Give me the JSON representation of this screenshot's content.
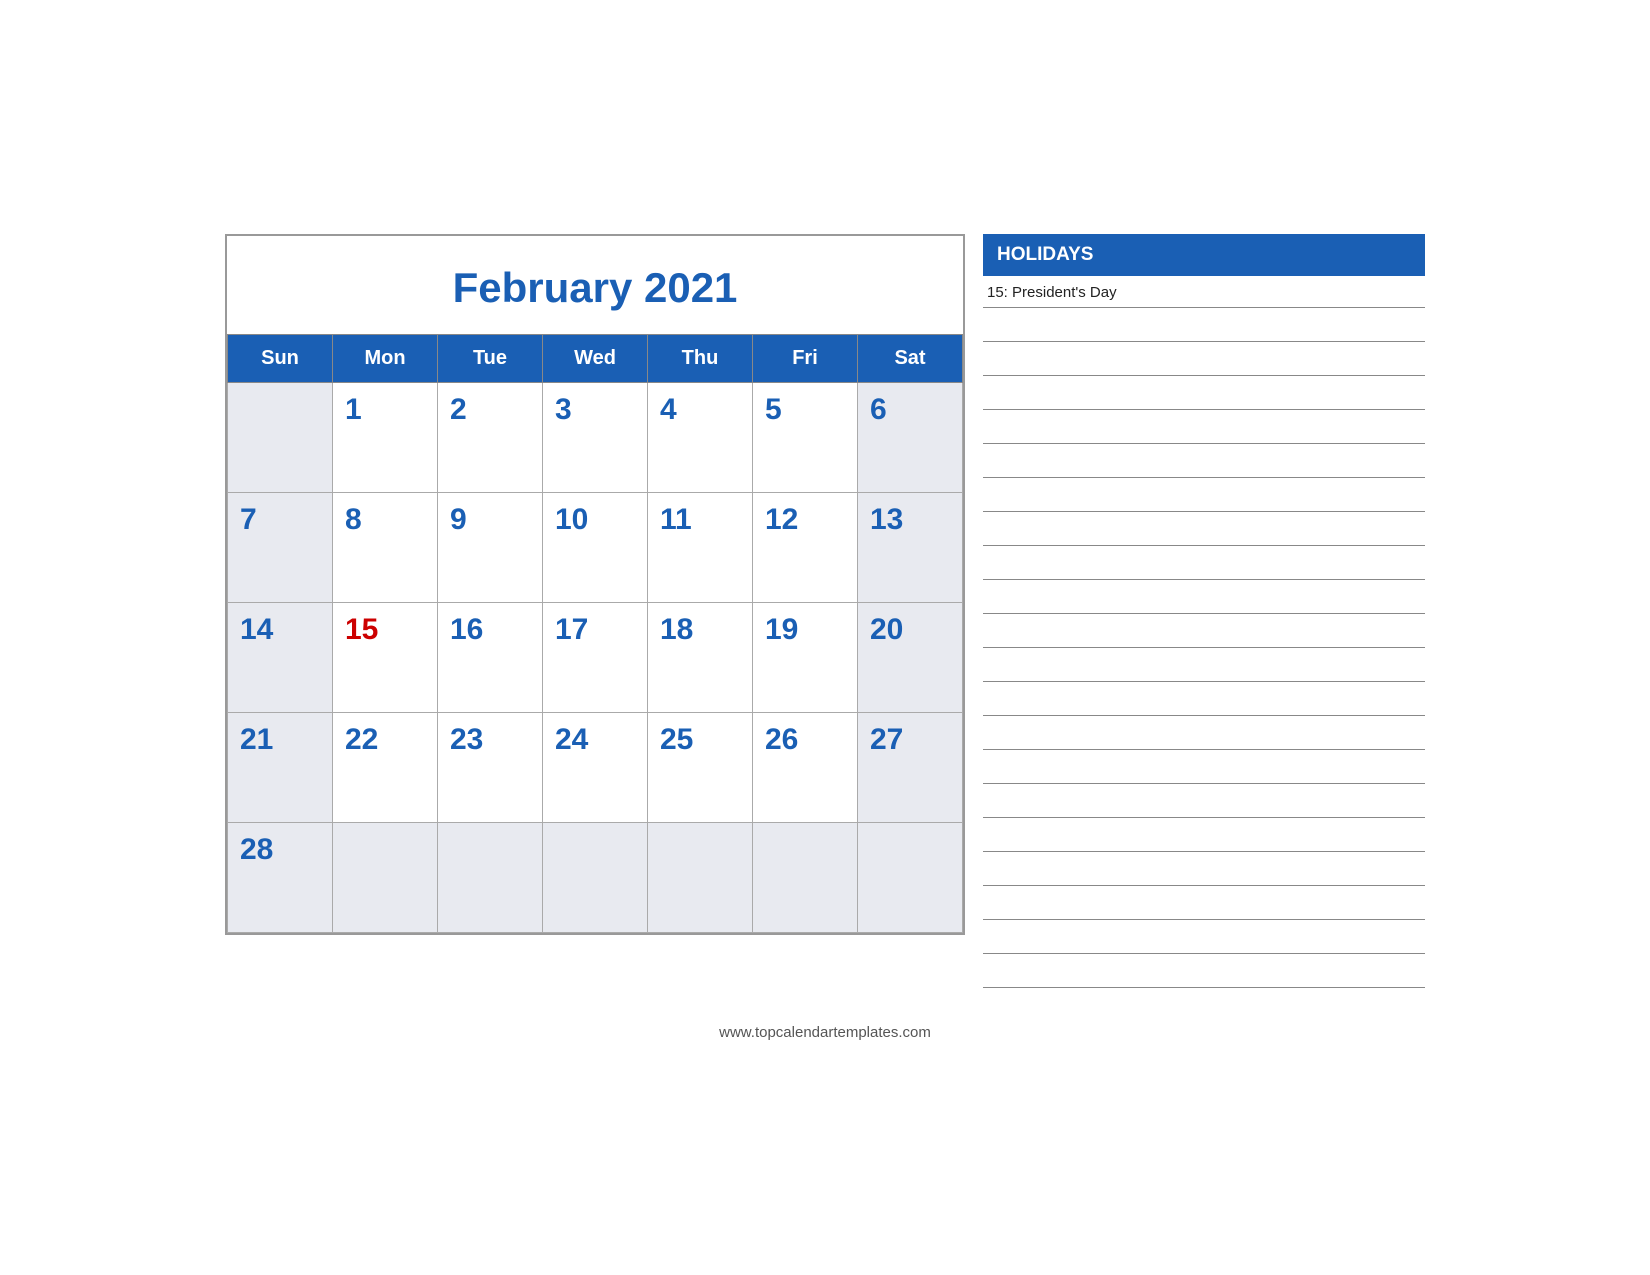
{
  "calendar": {
    "title": "February 2021",
    "days_of_week": [
      "Sun",
      "Mon",
      "Tue",
      "Wed",
      "Thu",
      "Fri",
      "Sat"
    ],
    "weeks": [
      [
        {
          "day": "",
          "empty": true
        },
        {
          "day": "1",
          "weekend": false
        },
        {
          "day": "2",
          "weekend": false
        },
        {
          "day": "3",
          "weekend": false
        },
        {
          "day": "4",
          "weekend": false
        },
        {
          "day": "5",
          "weekend": false
        },
        {
          "day": "6",
          "weekend": true
        }
      ],
      [
        {
          "day": "7",
          "weekend": true
        },
        {
          "day": "8",
          "weekend": false
        },
        {
          "day": "9",
          "weekend": false
        },
        {
          "day": "10",
          "weekend": false
        },
        {
          "day": "11",
          "weekend": false
        },
        {
          "day": "12",
          "weekend": false
        },
        {
          "day": "13",
          "weekend": true
        }
      ],
      [
        {
          "day": "14",
          "weekend": true
        },
        {
          "day": "15",
          "weekend": false,
          "holiday": true
        },
        {
          "day": "16",
          "weekend": false
        },
        {
          "day": "17",
          "weekend": false
        },
        {
          "day": "18",
          "weekend": false
        },
        {
          "day": "19",
          "weekend": false
        },
        {
          "day": "20",
          "weekend": true
        }
      ],
      [
        {
          "day": "21",
          "weekend": true
        },
        {
          "day": "22",
          "weekend": false
        },
        {
          "day": "23",
          "weekend": false
        },
        {
          "day": "24",
          "weekend": false
        },
        {
          "day": "25",
          "weekend": false
        },
        {
          "day": "26",
          "weekend": false
        },
        {
          "day": "27",
          "weekend": true
        }
      ],
      [
        {
          "day": "28",
          "weekend": true
        },
        {
          "day": "",
          "empty": true
        },
        {
          "day": "",
          "empty": true
        },
        {
          "day": "",
          "empty": true
        },
        {
          "day": "",
          "empty": true
        },
        {
          "day": "",
          "empty": true
        },
        {
          "day": "",
          "empty": true
        }
      ]
    ]
  },
  "holidays": {
    "header": "HOLIDAYS",
    "items": [
      "15: President's Day"
    ]
  },
  "note_lines_count": 20,
  "footer": {
    "website": "www.topcalendartemplates.com"
  }
}
